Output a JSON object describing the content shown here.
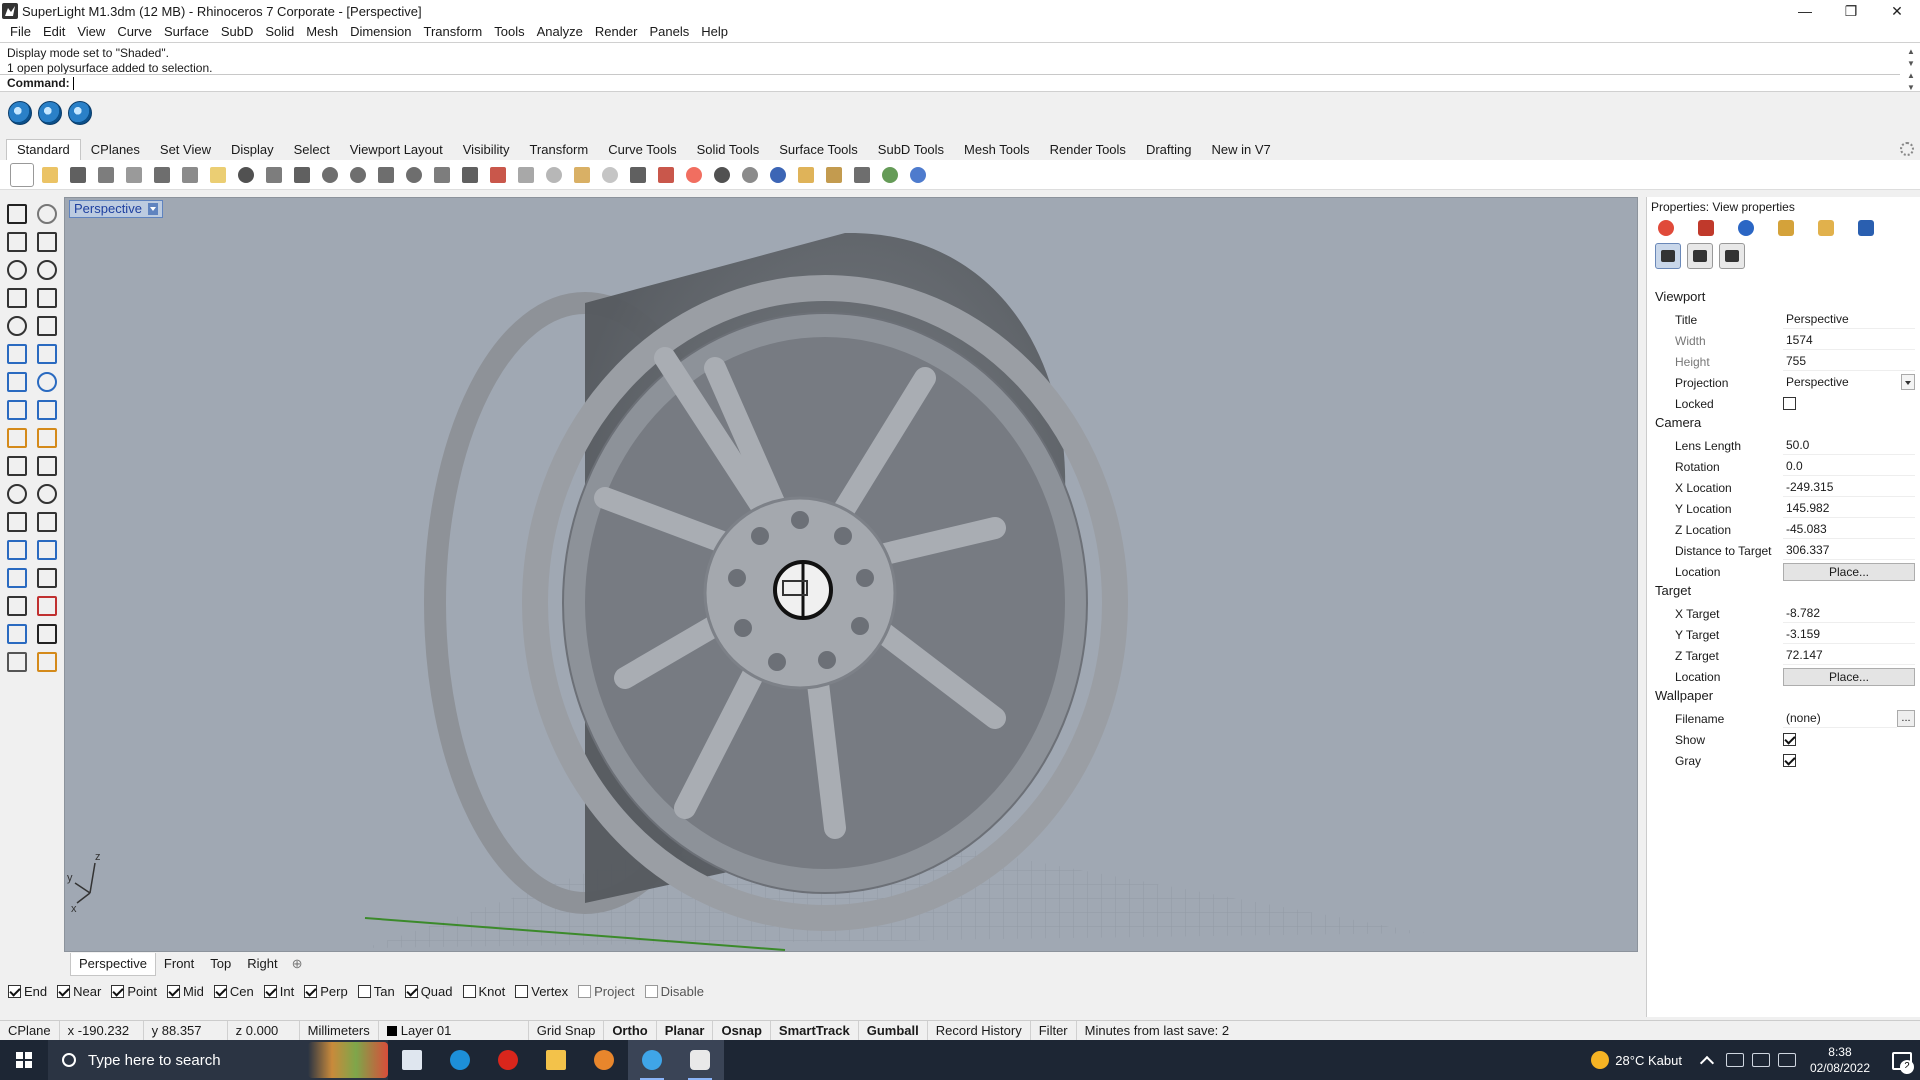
{
  "window": {
    "title": "SuperLight M1.3dm (12 MB) - Rhinoceros 7 Corporate - [Perspective]",
    "controls": [
      "—",
      "❐",
      "✕"
    ]
  },
  "menu": [
    "File",
    "Edit",
    "View",
    "Curve",
    "Surface",
    "SubD",
    "Solid",
    "Mesh",
    "Dimension",
    "Transform",
    "Tools",
    "Analyze",
    "Render",
    "Panels",
    "Help"
  ],
  "command": {
    "history": [
      "Display mode set to \"Shaded\".",
      "1 open polysurface added to selection."
    ],
    "prompt": "Command:"
  },
  "plugins": [
    "plugin-icon-1",
    "plugin-icon-2",
    "plugin-icon-3"
  ],
  "toolbar_tabs": [
    "Standard",
    "CPlanes",
    "Set View",
    "Display",
    "Select",
    "Viewport Layout",
    "Visibility",
    "Transform",
    "Curve Tools",
    "Solid Tools",
    "Surface Tools",
    "SubD Tools",
    "Mesh Tools",
    "Render Tools",
    "Drafting",
    "New in V7"
  ],
  "active_tab": "Standard",
  "viewport": {
    "title": "Perspective",
    "tabs": [
      "Perspective",
      "Front",
      "Top",
      "Right"
    ],
    "active_tab": "Perspective",
    "axis_labels": {
      "x": "x",
      "y": "y",
      "z": "z"
    }
  },
  "osnap": [
    {
      "label": "End",
      "checked": true,
      "enabled": true
    },
    {
      "label": "Near",
      "checked": true,
      "enabled": true
    },
    {
      "label": "Point",
      "checked": true,
      "enabled": true
    },
    {
      "label": "Mid",
      "checked": true,
      "enabled": true
    },
    {
      "label": "Cen",
      "checked": true,
      "enabled": true
    },
    {
      "label": "Int",
      "checked": true,
      "enabled": true
    },
    {
      "label": "Perp",
      "checked": true,
      "enabled": true
    },
    {
      "label": "Tan",
      "checked": false,
      "enabled": true
    },
    {
      "label": "Quad",
      "checked": true,
      "enabled": true
    },
    {
      "label": "Knot",
      "checked": false,
      "enabled": true
    },
    {
      "label": "Vertex",
      "checked": false,
      "enabled": true
    },
    {
      "label": "Project",
      "checked": false,
      "enabled": false
    },
    {
      "label": "Disable",
      "checked": false,
      "enabled": false
    }
  ],
  "status": {
    "cplane": "CPlane",
    "x": "x -190.232",
    "y": "y 88.357",
    "z": "z 0.000",
    "units": "Millimeters",
    "layer": "Layer 01",
    "grid_snap": "Grid Snap",
    "ortho": "Ortho",
    "planar": "Planar",
    "osnap": "Osnap",
    "smarttrack": "SmartTrack",
    "gumball": "Gumball",
    "record_history": "Record History",
    "filter": "Filter",
    "save_info": "Minutes from last save: 2"
  },
  "properties": {
    "title": "Properties: View properties",
    "sections": {
      "viewport": "Viewport",
      "camera": "Camera",
      "target": "Target",
      "wallpaper": "Wallpaper"
    },
    "viewport": {
      "title_label": "Title",
      "title_value": "Perspective",
      "width_label": "Width",
      "width_value": "1574",
      "height_label": "Height",
      "height_value": "755",
      "projection_label": "Projection",
      "projection_value": "Perspective",
      "locked_label": "Locked"
    },
    "camera": {
      "lens_label": "Lens Length",
      "lens_value": "50.0",
      "rotation_label": "Rotation",
      "rotation_value": "0.0",
      "xloc_label": "X Location",
      "xloc_value": "-249.315",
      "yloc_label": "Y Location",
      "yloc_value": "145.982",
      "zloc_label": "Z Location",
      "zloc_value": "-45.083",
      "dist_label": "Distance to Target",
      "dist_value": "306.337",
      "location_label": "Location",
      "location_button": "Place..."
    },
    "target": {
      "x_label": "X Target",
      "x_value": "-8.782",
      "y_label": "Y Target",
      "y_value": "-3.159",
      "z_label": "Z Target",
      "z_value": "72.147",
      "location_label": "Location",
      "location_button": "Place..."
    },
    "wallpaper": {
      "filename_label": "Filename",
      "filename_value": "(none)",
      "browse": "...",
      "show_label": "Show",
      "gray_label": "Gray"
    }
  },
  "taskbar": {
    "search_placeholder": "Type here to search",
    "weather": "28°C Kabut",
    "time": "8:38",
    "date": "02/08/2022",
    "notifications": "2"
  }
}
